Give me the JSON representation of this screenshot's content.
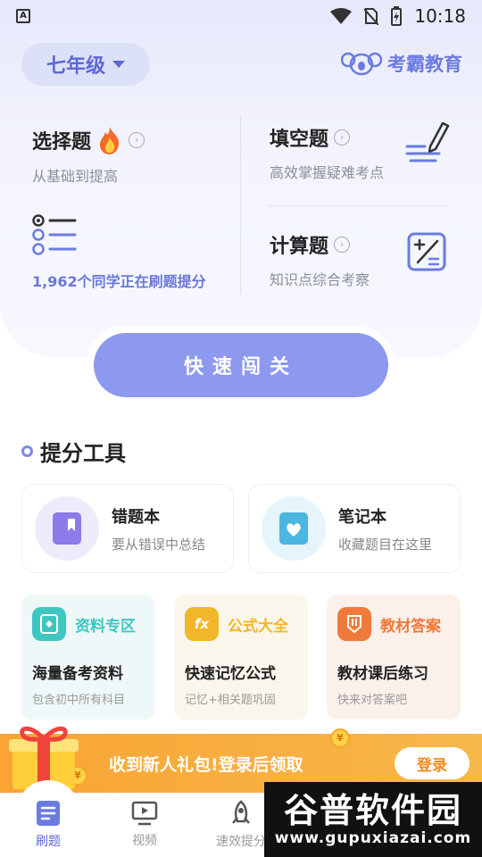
{
  "status_bar": {
    "time": "10:18"
  },
  "header": {
    "grade_label": "七年级",
    "brand_name": "考霸教育"
  },
  "cards": {
    "choice": {
      "title": "选择题",
      "subtitle": "从基础到提高"
    },
    "fill": {
      "title": "填空题",
      "subtitle": "高效掌握疑难考点"
    },
    "calc": {
      "title": "计算题",
      "subtitle": "知识点综合考察"
    },
    "stat_text": "1,962个同学正在刷题提分"
  },
  "quick_button": "快速闯关",
  "tools_section": {
    "title": "提分工具",
    "tools": [
      {
        "title": "错题本",
        "subtitle": "要从错误中总结",
        "icon": "bookmark-book-icon"
      },
      {
        "title": "笔记本",
        "subtitle": "收藏题目在这里",
        "icon": "heart-book-icon"
      }
    ]
  },
  "resources": [
    {
      "tag": "资料专区",
      "title": "海量备考资料",
      "subtitle": "包含初中所有科目",
      "color": "#3fc6c0",
      "bg": "#eef8f8"
    },
    {
      "tag": "公式大全",
      "title": "快速记忆公式",
      "subtitle": "记忆+相关题巩固",
      "color": "#f2b62a",
      "bg": "#fbf6ec"
    },
    {
      "tag": "教材答案",
      "title": "教材课后练习",
      "subtitle": "快来对答案吧",
      "color": "#f07a3a",
      "bg": "#fcf1ea"
    }
  ],
  "resource_icons": {
    "formula": "fx"
  },
  "banner": {
    "text": "收到新人礼包!登录后领取",
    "login_label": "登录",
    "coin_symbol": "¥"
  },
  "nav": {
    "items": [
      {
        "label": "刷题",
        "icon": "practice-book-icon"
      },
      {
        "label": "视频",
        "icon": "video-icon"
      },
      {
        "label": "速效提分",
        "icon": "rocket-icon"
      }
    ]
  },
  "watermark": {
    "big": "谷普软件园",
    "small": "www.gupuxiazai.com"
  },
  "colors": {
    "accent": "#5c68d6",
    "button": "#8d99ef",
    "banner": "#f9a434"
  }
}
